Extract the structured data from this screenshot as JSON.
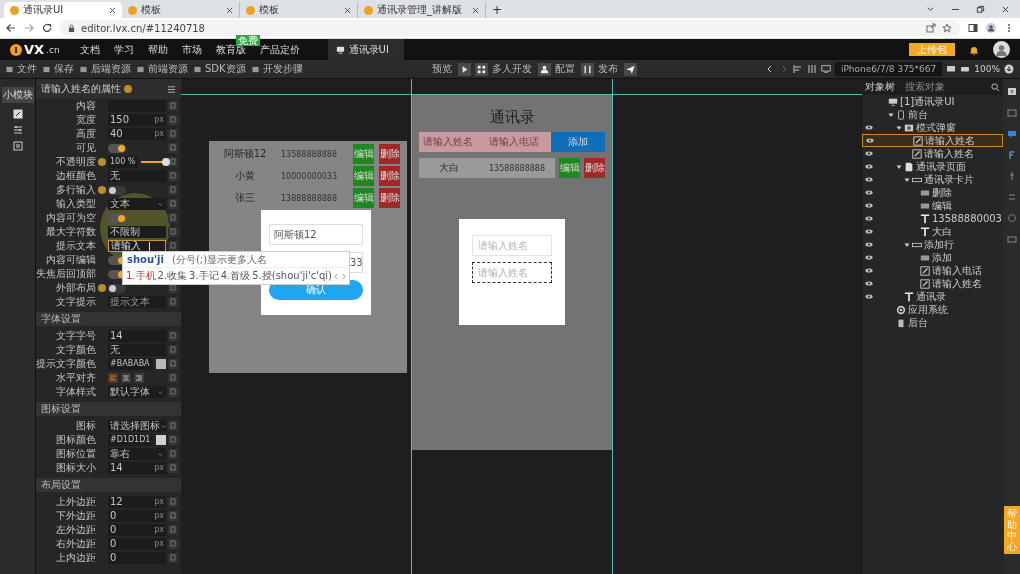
{
  "browser": {
    "tabs": [
      {
        "title": "通讯录UI",
        "selected": true
      },
      {
        "title": "模板",
        "selected": false
      },
      {
        "title": "模板",
        "selected": false
      },
      {
        "title": "通讯录管理_讲解版",
        "selected": false
      }
    ],
    "new_tab": "+",
    "url": "editor.lvx.cn/#11240718"
  },
  "app": {
    "logo": "VX",
    "logo_suffix": ".cn",
    "nav": [
      {
        "label": "文档"
      },
      {
        "label": "学习"
      },
      {
        "label": "帮助"
      },
      {
        "label": "市场"
      },
      {
        "label": "教育版",
        "badge": "免费"
      },
      {
        "label": "产品定价"
      }
    ],
    "project_tab": "通讯录UI",
    "upload_button": "上传包"
  },
  "toolbar": {
    "left": [
      "文件",
      "保存",
      "后端资源",
      "前端资源",
      "SDK资源",
      "开发步骤"
    ],
    "right": [
      "预览",
      "多人开发",
      "配置",
      "发布"
    ],
    "device": "iPhone6/7/8 375*667",
    "zoom": "100%"
  },
  "props": {
    "side_tab": "小模块",
    "title": "请输入姓名的属性",
    "rows": [
      {
        "kind": "text",
        "label": "内容",
        "focused": false
      },
      {
        "kind": "text",
        "label": "宽度",
        "value": "150",
        "unit": "px",
        "focused": false
      },
      {
        "kind": "text",
        "label": "高度",
        "value": "40",
        "unit": "px",
        "focused": false
      },
      {
        "kind": "toggle",
        "label": "可见",
        "on": true,
        "help": false
      },
      {
        "kind": "slider",
        "label": "不透明度",
        "reading": "100 %",
        "level": 1,
        "help": true
      },
      {
        "kind": "text",
        "label": "边框颜色",
        "value": "无",
        "focused": false
      },
      {
        "kind": "toggle",
        "label": "多行输入",
        "on": false,
        "help": true
      },
      {
        "kind": "select",
        "label": "输入类型",
        "value": "文本"
      },
      {
        "kind": "toggle",
        "label": "内容可为空",
        "on": true,
        "help": false
      },
      {
        "kind": "text",
        "label": "最大字符数",
        "value": "不限制",
        "focused": false
      },
      {
        "kind": "text",
        "label": "提示文本",
        "value": "请输入",
        "focused": true
      },
      {
        "kind": "toggle",
        "label": "内容可编辑",
        "on": true,
        "help": false
      },
      {
        "kind": "toggle",
        "label": "失焦后回顶部",
        "on": true,
        "help": false
      },
      {
        "kind": "toggle",
        "label": "外部布局",
        "on": false,
        "help": true
      },
      {
        "kind": "text",
        "label": "文字提示",
        "placeholder": "提示文本",
        "focused": false
      }
    ],
    "sections": [
      {
        "title": "字体设置",
        "rows": [
          {
            "kind": "text",
            "label": "文字字号",
            "value": "14",
            "focused": false
          },
          {
            "kind": "text",
            "label": "文字颜色",
            "value": "无",
            "focused": false
          },
          {
            "kind": "color",
            "label": "提示文字颜色",
            "value": "#BABABA"
          },
          {
            "kind": "align",
            "label": "水平对齐",
            "options": [
              {
                "selected": true
              },
              {
                "selected": false
              },
              {
                "selected": false
              }
            ]
          },
          {
            "kind": "select",
            "label": "字体样式",
            "value": "默认字体"
          }
        ]
      },
      {
        "title": "图标设置",
        "rows": [
          {
            "kind": "select",
            "label": "图标",
            "value": "请选择图标"
          },
          {
            "kind": "color",
            "label": "图标颜色",
            "value": "#D1D1D1"
          },
          {
            "kind": "select",
            "label": "图标位置",
            "value": "靠右"
          },
          {
            "kind": "text",
            "label": "图标大小",
            "value": "14",
            "unit": "px",
            "focused": false
          }
        ]
      },
      {
        "title": "布局设置",
        "rows": [
          {
            "kind": "text",
            "label": "上外边距",
            "value": "12",
            "unit": "px",
            "focused": false
          },
          {
            "kind": "text",
            "label": "下外边距",
            "value": "0",
            "unit": "px",
            "focused": false
          },
          {
            "kind": "text",
            "label": "左外边距",
            "value": "0",
            "unit": "px",
            "focused": false
          },
          {
            "kind": "text",
            "label": "右外边距",
            "value": "0",
            "unit": "px",
            "focused": false
          },
          {
            "kind": "text",
            "label": "上内边距",
            "value": "0",
            "focused": false
          }
        ]
      }
    ]
  },
  "ime": {
    "input": "shou'ji",
    "hint": "(分号(;)显示更多人名",
    "candidates": [
      {
        "text": "1.手机",
        "selected": true
      },
      {
        "text": "2.收集",
        "selected": false
      },
      {
        "text": "3.手记",
        "selected": false
      },
      {
        "text": "4.首级",
        "selected": false
      },
      {
        "text": "5.授(shou'ji'c'qi)",
        "selected": false
      }
    ]
  },
  "preview_left": {
    "contacts": [
      {
        "name": "阿斯顿12",
        "phone": "13588888888",
        "edit": "编辑",
        "delete": "删除"
      },
      {
        "name": "小黄",
        "phone": "10000000033",
        "edit": "编辑",
        "delete": "删除"
      },
      {
        "name": "张三",
        "phone": "13888888888",
        "edit": "编辑",
        "delete": "删除"
      }
    ],
    "dialog": {
      "fields": [
        {
          "value": "阿斯顿12"
        },
        {
          "value": "33"
        }
      ],
      "confirm": "确认"
    }
  },
  "phone": {
    "title": "通讯录",
    "add_fields": [
      {
        "placeholder": "请输入姓名"
      },
      {
        "placeholder": "请输入电话"
      }
    ],
    "add_button": "添加",
    "contacts": [
      {
        "name": "大白",
        "phone": "13588888888",
        "edit": "编辑",
        "delete": "删除"
      }
    ],
    "dialog": {
      "fields": [
        {
          "placeholder": "请输入姓名",
          "selected": false
        },
        {
          "placeholder": "请输入姓名",
          "selected": true
        }
      ]
    }
  },
  "tree": {
    "tab": "对象树",
    "search_placeholder": "搜索对象",
    "nodes": [
      {
        "label": "[1]通讯录UI",
        "kind": "app",
        "eye": false,
        "selected": false,
        "children": [
          {
            "label": "前台",
            "kind": "device",
            "eye": false,
            "selected": false,
            "expanded": true,
            "children": [
              {
                "label": "模式弹窗",
                "kind": "popup",
                "eye": true,
                "selected": false,
                "expanded": true,
                "children": [
                  {
                    "label": "请输入姓名",
                    "kind": "input",
                    "eye": true,
                    "selected": true
                  },
                  {
                    "label": "请输入姓名",
                    "kind": "input",
                    "eye": true,
                    "selected": false
                  }
                ]
              },
              {
                "label": "通讯录页面",
                "kind": "page",
                "eye": true,
                "selected": false,
                "expanded": true,
                "children": [
                  {
                    "label": "通讯录卡片",
                    "kind": "row",
                    "eye": true,
                    "selected": false,
                    "expanded": true,
                    "children": [
                      {
                        "label": "删除",
                        "kind": "button",
                        "eye": true,
                        "selected": false
                      },
                      {
                        "label": "编辑",
                        "kind": "button",
                        "eye": true,
                        "selected": false
                      },
                      {
                        "label": "13588880003",
                        "kind": "text",
                        "eye": true,
                        "selected": false
                      },
                      {
                        "label": "大白",
                        "kind": "text",
                        "eye": true,
                        "selected": false
                      }
                    ]
                  },
                  {
                    "label": "添加行",
                    "kind": "row",
                    "eye": true,
                    "selected": false,
                    "expanded": true,
                    "children": [
                      {
                        "label": "添加",
                        "kind": "button",
                        "eye": true,
                        "selected": false
                      },
                      {
                        "label": "请输入电话",
                        "kind": "input",
                        "eye": true,
                        "selected": false
                      },
                      {
                        "label": "请输入姓名",
                        "kind": "input",
                        "eye": true,
                        "selected": false
                      }
                    ]
                  }
                ]
              },
              {
                "label": "通讯录",
                "kind": "text",
                "eye": true,
                "selected": false
              }
            ]
          },
          {
            "label": "应用系统",
            "kind": "gear",
            "eye": false,
            "selected": false
          },
          {
            "label": "后台",
            "kind": "server",
            "eye": false,
            "selected": false
          }
        ]
      }
    ]
  },
  "help_float": "帮助中心"
}
